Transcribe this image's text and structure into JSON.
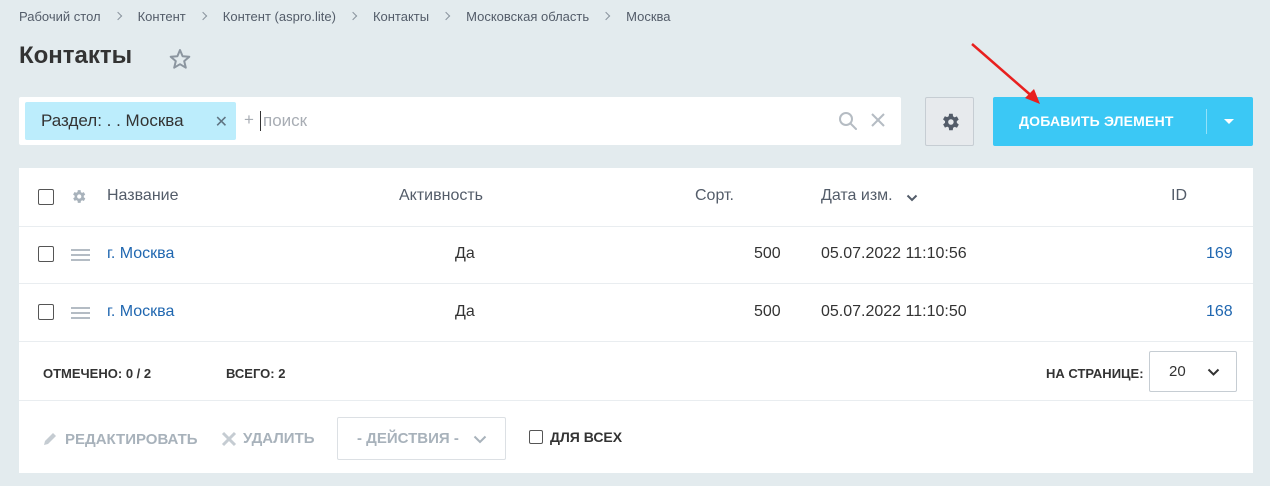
{
  "breadcrumbs": [
    "Рабочий стол",
    "Контент",
    "Контент (aspro.lite)",
    "Контакты",
    "Московская область",
    "Москва"
  ],
  "page": {
    "title": "Контакты"
  },
  "filter": {
    "tag_label": "Раздел: . . Москва",
    "plus": "+",
    "search_placeholder": "поиск"
  },
  "toolbar": {
    "add_label": "ДОБАВИТЬ ЭЛЕМЕНТ"
  },
  "table": {
    "columns": [
      "Название",
      "Активность",
      "Сорт.",
      "Дата изм.",
      "ID"
    ],
    "rows": [
      {
        "name": "г. Москва",
        "active": "Да",
        "sort": "500",
        "date": "05.07.2022 11:10:56",
        "id": "169"
      },
      {
        "name": "г. Москва",
        "active": "Да",
        "sort": "500",
        "date": "05.07.2022 11:10:50",
        "id": "168"
      }
    ]
  },
  "footer": {
    "checked_label": "ОТМЕЧЕНО:",
    "checked_value": "0 / 2",
    "total_label": "ВСЕГО:",
    "total_value": "2",
    "per_page_label": "НА СТРАНИЦЕ:",
    "per_page_value": "20"
  },
  "actions": {
    "edit_label": "РЕДАКТИРОВАТЬ",
    "delete_label": "УДАЛИТЬ",
    "actions_select": "- ДЕЙСТВИЯ -",
    "for_all_label": "ДЛЯ ВСЕХ"
  },
  "colors": {
    "accent": "#3bc8f5",
    "tag_bg": "#bcedfc",
    "link": "#2067b0",
    "page_bg": "#e3ebee",
    "arrow": "#e8201f"
  },
  "icons": [
    "star-icon",
    "close-icon",
    "search-icon",
    "gear-icon",
    "chevron-down-icon",
    "drag-handle-icon",
    "pencil-icon"
  ]
}
